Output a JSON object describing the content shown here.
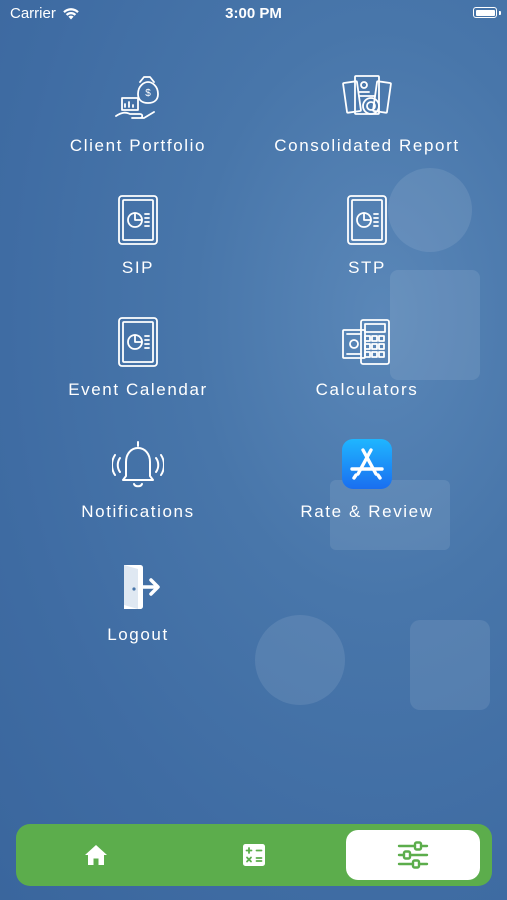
{
  "status_bar": {
    "carrier": "Carrier",
    "time": "3:00 PM"
  },
  "menu": {
    "items": [
      {
        "label": "Client Portfolio",
        "icon": "money-bag-chart-icon"
      },
      {
        "label": "Consolidated Report",
        "icon": "report-stack-icon"
      },
      {
        "label": "SIP",
        "icon": "pie-report-icon"
      },
      {
        "label": "STP",
        "icon": "pie-report-icon"
      },
      {
        "label": "Event Calendar",
        "icon": "pie-report-icon"
      },
      {
        "label": "Calculators",
        "icon": "calculator-cash-icon"
      },
      {
        "label": "Notifications",
        "icon": "bell-icon"
      },
      {
        "label": "Rate & Review",
        "icon": "app-store-icon"
      },
      {
        "label": "Logout",
        "icon": "logout-door-icon"
      }
    ]
  },
  "tabbar": {
    "tabs": [
      {
        "name": "home",
        "icon": "home-icon",
        "active": false
      },
      {
        "name": "calculator",
        "icon": "calculator-icon",
        "active": false
      },
      {
        "name": "settings",
        "icon": "sliders-icon",
        "active": true
      }
    ],
    "accent_color": "#5cad4c"
  },
  "colors": {
    "background": "#4876aa",
    "text": "#ffffff"
  }
}
